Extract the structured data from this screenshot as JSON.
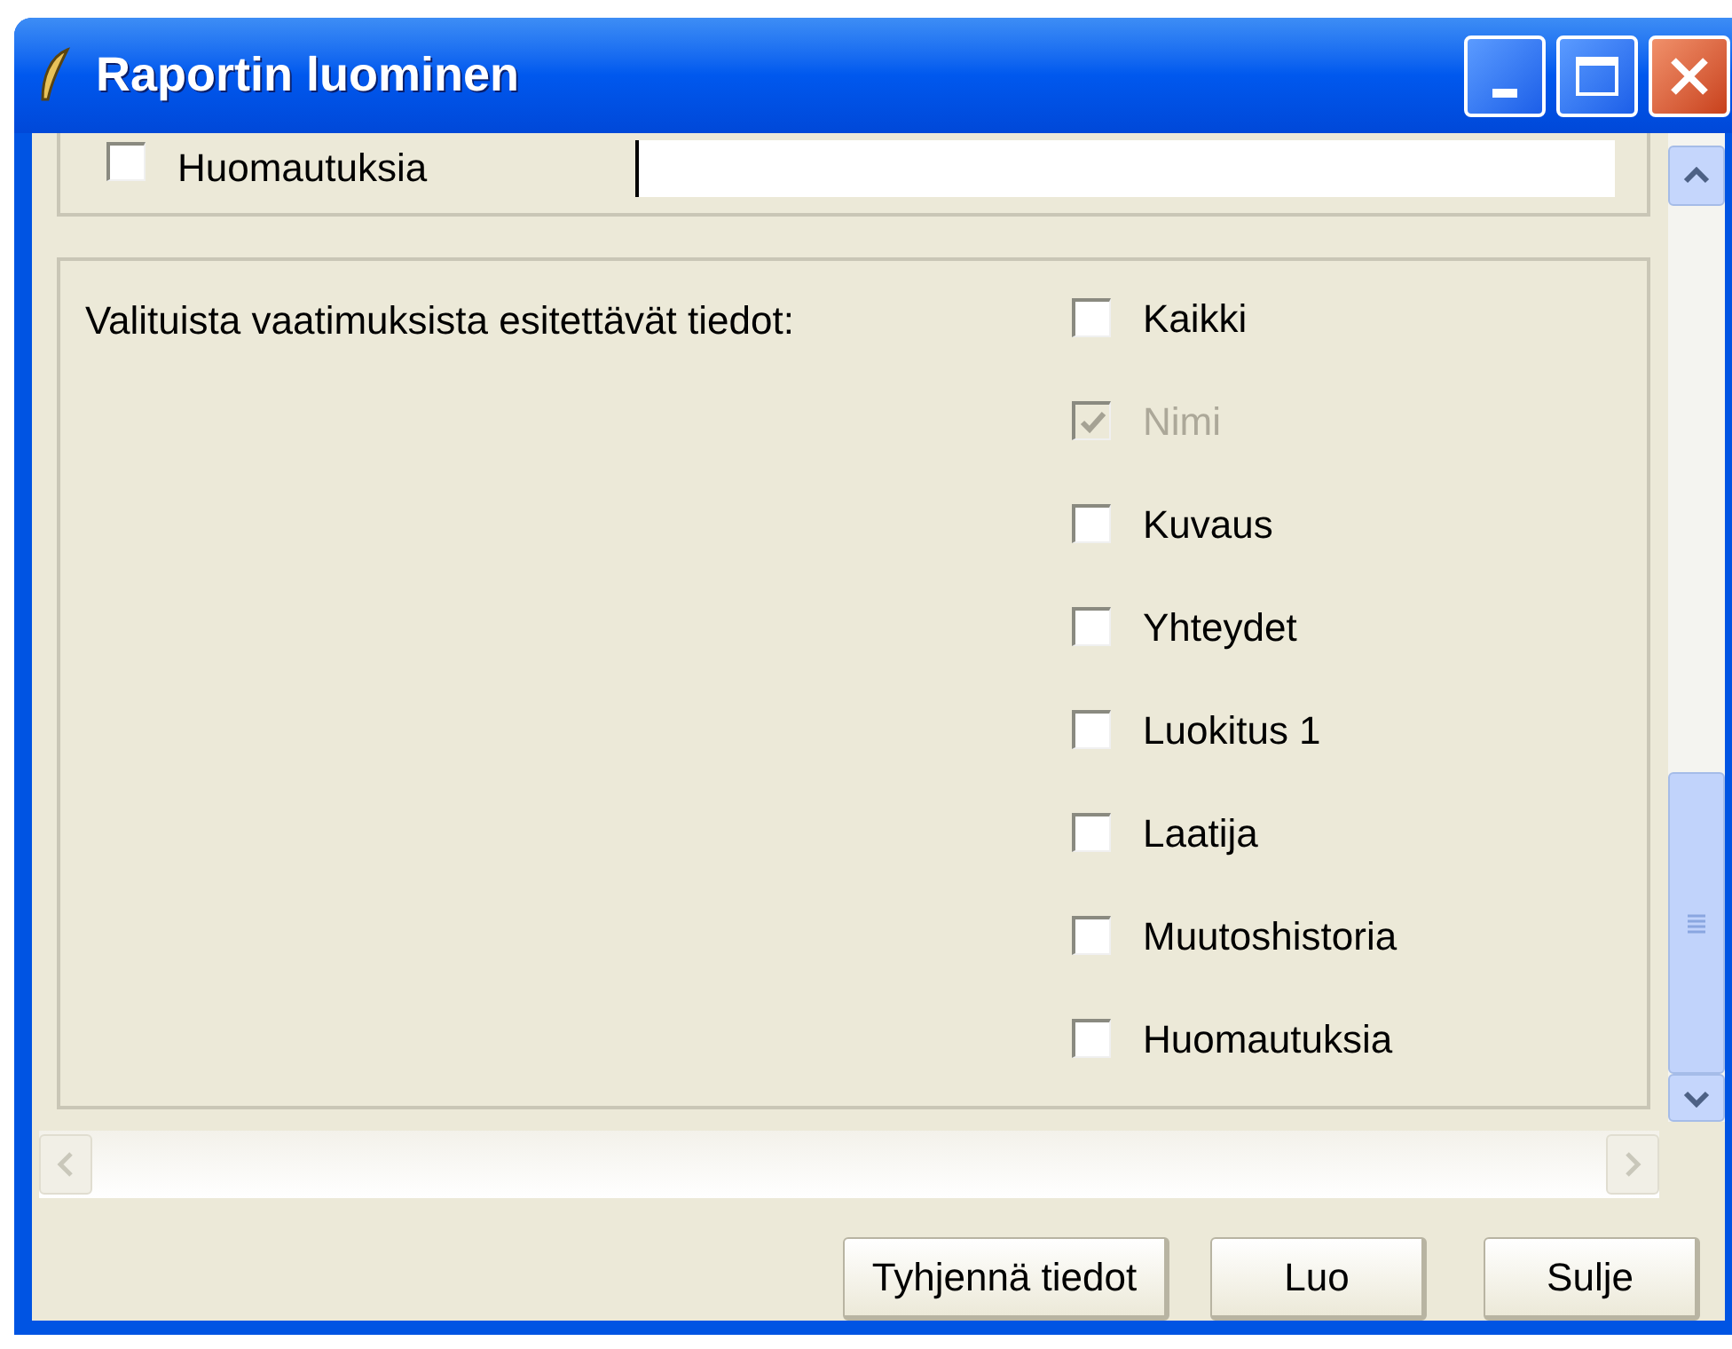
{
  "window": {
    "title": "Raportin luominen"
  },
  "top_row": {
    "label": "Huomautuksia",
    "checked": false
  },
  "section": {
    "label": "Valituista vaatimuksista esitettävät tiedot:",
    "options": [
      {
        "label": "Kaikki",
        "checked": false,
        "disabled": false
      },
      {
        "label": "Nimi",
        "checked": true,
        "disabled": true
      },
      {
        "label": "Kuvaus",
        "checked": false,
        "disabled": false
      },
      {
        "label": "Yhteydet",
        "checked": false,
        "disabled": false
      },
      {
        "label": "Luokitus 1",
        "checked": false,
        "disabled": false
      },
      {
        "label": "Laatija",
        "checked": false,
        "disabled": false
      },
      {
        "label": "Muutoshistoria",
        "checked": false,
        "disabled": false
      },
      {
        "label": "Huomautuksia",
        "checked": false,
        "disabled": false
      }
    ]
  },
  "buttons": [
    "Tyhjennä tiedot",
    "Luo",
    "Sulje"
  ]
}
